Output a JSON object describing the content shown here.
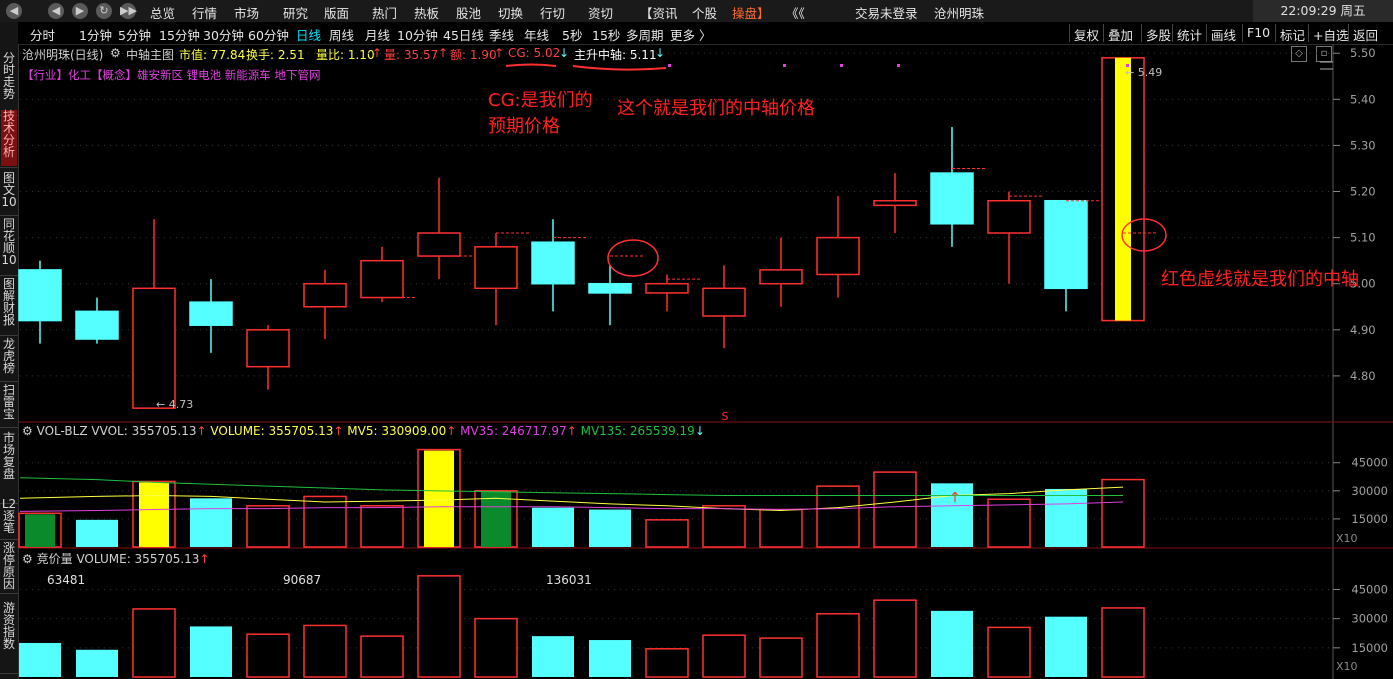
{
  "topbar": {
    "menu": [
      "总览",
      "行情",
      "市场",
      "研究",
      "版面",
      "热门",
      "热板",
      "股池",
      "切换",
      "行切",
      "资切",
      "【资讯",
      "个股",
      "操盘】",
      "《《"
    ],
    "active_menu": "操盘】",
    "login": "交易未登录",
    "stock_name": "沧州明珠",
    "clock": "22:09:29 周五",
    "window_btns": [
      "◀",
      "▶",
      "↻",
      "▶▶"
    ]
  },
  "periodbar": {
    "periods": [
      "分时",
      "1分钟",
      "5分钟",
      "15分钟",
      "30分钟",
      "60分钟",
      "日线",
      "周线",
      "月线",
      "10分钟",
      "45日线",
      "季线",
      "年线",
      "5秒",
      "15秒",
      "多周期",
      "更多 〉"
    ],
    "active": "日线",
    "tools": [
      "复权",
      "叠加",
      "多股",
      "统计",
      "画线",
      "F10",
      "标记",
      "+自选",
      "返回"
    ]
  },
  "sidebar": {
    "items": [
      "分时走势",
      "技术分析",
      "图文10",
      "同花顺10",
      "图解财报",
      "龙虎榜",
      "扫雷宝",
      "市场复盘",
      "L2逐笔",
      "涨停原因",
      "游资指数"
    ],
    "active": "技术分析"
  },
  "info": {
    "title": "沧州明珠(日线)",
    "indicator": "中轴主图",
    "mktcap": "市值: 77.84",
    "turnover": "换手: 2.51",
    "ratio": "量比: 1.10",
    "vol": "量: 35.57",
    "amount": "额: 1.90",
    "cg": "CG: 5.02",
    "axis": "主升中轴: 5.11",
    "tags": "【行业】化工【概念】雄安新区 锂电池 新能源车 地下管网"
  },
  "annotations": {
    "cg_note_1": "CG:是我们的",
    "cg_note_2": "预期价格",
    "axis_note": "这个就是我们的中轴价格",
    "dash_note": "红色虚线就是我们的中轴"
  },
  "vol_panel": {
    "title": "VOL-BLZ",
    "vvol": "VVOL: 355705.13",
    "volume": "VOLUME: 355705.13",
    "mv5": "MV5: 330909.00",
    "mv35": "MV35: 246717.97",
    "mv135": "MV135: 265539.19",
    "x10": "X10"
  },
  "auction_panel": {
    "title": "竞价量",
    "volume": "VOLUME: 355705.13",
    "labels": [
      "63481",
      "90687",
      "136031"
    ],
    "x10": "X10"
  },
  "colors": {
    "up": "#ff3030",
    "down": "#55ffff",
    "yellow": "#ffff00",
    "green": "#0a8a2a",
    "ma5": "#ffff40",
    "ma35": "#e040e0",
    "ma135": "#20c040"
  },
  "chart_data": [
    {
      "type": "candlestick",
      "title": "沧州明珠(日线)",
      "ylim": [
        4.7,
        5.52
      ],
      "yticks": [
        4.8,
        4.9,
        5.0,
        5.1,
        5.2,
        5.3,
        5.4,
        5.5
      ],
      "candles": [
        {
          "open": 5.03,
          "close": 4.92,
          "high": 5.05,
          "low": 4.87,
          "axis": null
        },
        {
          "open": 4.94,
          "close": 4.88,
          "high": 4.97,
          "low": 4.87,
          "axis": null
        },
        {
          "open": 4.73,
          "close": 4.99,
          "high": 5.14,
          "low": 4.73,
          "axis": null
        },
        {
          "open": 4.96,
          "close": 4.91,
          "high": 5.01,
          "low": 4.85,
          "axis": null
        },
        {
          "open": 4.82,
          "close": 4.9,
          "high": 4.91,
          "low": 4.77,
          "axis": null
        },
        {
          "open": 4.95,
          "close": 5.0,
          "high": 5.03,
          "low": 4.88,
          "axis": null
        },
        {
          "open": 4.97,
          "close": 5.05,
          "high": 5.08,
          "low": 4.96,
          "axis": 4.97
        },
        {
          "open": 5.06,
          "close": 5.11,
          "high": 5.23,
          "low": 5.01,
          "axis": 5.06
        },
        {
          "open": 4.99,
          "close": 5.08,
          "high": 5.11,
          "low": 4.91,
          "axis": 5.11
        },
        {
          "open": 5.09,
          "close": 5.0,
          "high": 5.14,
          "low": 4.94,
          "axis": 5.1
        },
        {
          "open": 5.0,
          "close": 4.98,
          "high": 5.04,
          "low": 4.91,
          "axis": 5.06
        },
        {
          "open": 4.98,
          "close": 5.0,
          "high": 5.02,
          "low": 4.94,
          "axis": 5.01
        },
        {
          "open": 4.93,
          "close": 4.99,
          "high": 5.04,
          "low": 4.86,
          "axis": null
        },
        {
          "open": 5.0,
          "close": 5.03,
          "high": 5.1,
          "low": 4.95,
          "axis": null
        },
        {
          "open": 5.02,
          "close": 5.1,
          "high": 5.19,
          "low": 4.97,
          "axis": null
        },
        {
          "open": 5.17,
          "close": 5.18,
          "high": 5.24,
          "low": 5.11,
          "axis": null
        },
        {
          "open": 5.24,
          "close": 5.13,
          "high": 5.34,
          "low": 5.08,
          "axis": 5.25
        },
        {
          "open": 5.11,
          "close": 5.18,
          "high": 5.2,
          "low": 5.0,
          "axis": 5.19
        },
        {
          "open": 5.18,
          "close": 4.99,
          "high": 5.18,
          "low": 4.94,
          "axis": 5.18
        },
        {
          "open": 4.92,
          "close": 5.49,
          "high": 5.49,
          "low": 4.92,
          "axis": 5.11
        }
      ],
      "price_labels": {
        "low": "4.73",
        "high": "5.49"
      }
    },
    {
      "type": "bar",
      "title": "VOL-BLZ",
      "ylim": [
        0,
        55000
      ],
      "yticks": [
        15000,
        30000,
        45000
      ],
      "values": [
        18000,
        14500,
        35000,
        26000,
        22000,
        27000,
        22000,
        52000,
        30000,
        21000,
        20000,
        14500,
        22000,
        20000,
        32500,
        40000,
        34000,
        25500,
        31000,
        36000
      ],
      "colors": [
        "green",
        "down",
        "yellow",
        "down",
        "up",
        "up",
        "up",
        "yellow",
        "green",
        "down",
        "down",
        "up",
        "up",
        "up",
        "up",
        "up",
        "down",
        "up",
        "down",
        "up"
      ],
      "series": [
        {
          "name": "MV5",
          "values": [
            26000,
            27000,
            27500,
            27000,
            25500,
            24000,
            24500,
            25000,
            26000,
            24500,
            23000,
            22000,
            20500,
            19500,
            21000,
            24000,
            27500,
            28500,
            30500,
            32000
          ]
        },
        {
          "name": "MV35",
          "values": [
            19000,
            19500,
            20000,
            20500,
            20500,
            21000,
            21000,
            21500,
            21500,
            21500,
            21000,
            20500,
            20500,
            20000,
            20500,
            21500,
            22000,
            22500,
            23000,
            24000
          ]
        },
        {
          "name": "MV135",
          "values": [
            37000,
            36000,
            34500,
            33500,
            32500,
            31500,
            30500,
            30000,
            29500,
            29000,
            28500,
            28000,
            27500,
            27500,
            27500,
            27500,
            27500,
            27500,
            27500,
            27500
          ]
        }
      ]
    },
    {
      "type": "bar",
      "title": "竞价量",
      "ylim": [
        0,
        55000
      ],
      "yticks": [
        15000,
        30000,
        45000
      ],
      "values": [
        17500,
        14000,
        35000,
        26000,
        22000,
        26500,
        21000,
        52000,
        30000,
        21000,
        19000,
        14500,
        21500,
        20000,
        32500,
        39500,
        34000,
        25500,
        31000,
        35500
      ],
      "colors": [
        "down",
        "down",
        "up",
        "down",
        "up",
        "up",
        "up",
        "up",
        "up",
        "down",
        "down",
        "up",
        "up",
        "up",
        "up",
        "up",
        "down",
        "up",
        "down",
        "up"
      ]
    }
  ]
}
